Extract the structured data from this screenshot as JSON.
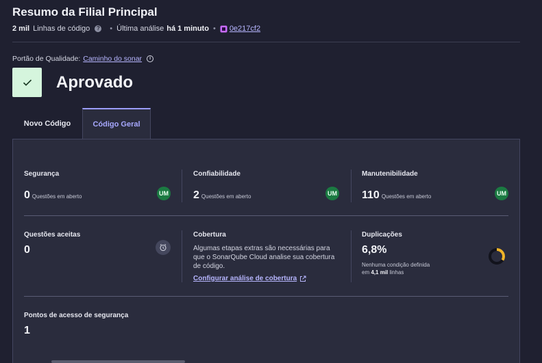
{
  "header": {
    "title": "Resumo da Filial Principal",
    "lines_count": "2 mil",
    "lines_label": "Linhas de código",
    "analysis_prefix": "Última análise",
    "analysis_time": "há 1 minuto",
    "commit": "0e217cf2"
  },
  "quality_gate": {
    "label": "Portão de Qualidade:",
    "link": "Caminho do sonar",
    "status": "Aprovado"
  },
  "tabs": [
    {
      "label": "Novo Código"
    },
    {
      "label": "Código Geral"
    }
  ],
  "metrics": {
    "security": {
      "label": "Segurança",
      "value": "0",
      "unit": "Questões em aberto",
      "grade": "UM"
    },
    "reliability": {
      "label": "Confiabilidade",
      "value": "2",
      "unit": "Questões em aberto",
      "grade": "UM"
    },
    "maintainability": {
      "label": "Manutenibilidade",
      "value": "110",
      "unit": "Questões em aberto",
      "grade": "UM"
    },
    "accepted": {
      "label": "Questões aceitas",
      "value": "0"
    },
    "coverage": {
      "label": "Cobertura",
      "description": "Algumas etapas extras são necessárias para que o SonarQube Cloud analise sua cobertura de código.",
      "link": "Configurar análise de cobertura"
    },
    "duplications": {
      "label": "Duplicações",
      "value": "6,8%",
      "note_line1": "Nenhuma condição definida",
      "note_prefix": "em",
      "note_lines": "4,1 mil",
      "note_suffix": "linhas",
      "percent": 6.8
    },
    "hotspots": {
      "label": "Pontos de acesso de segurança",
      "value": "1"
    }
  },
  "colors": {
    "accent": "#a7a8ff",
    "grade_green": "#1b7a42",
    "passed_bg": "#d5f5dd",
    "donut_fill": "#f0b429"
  }
}
